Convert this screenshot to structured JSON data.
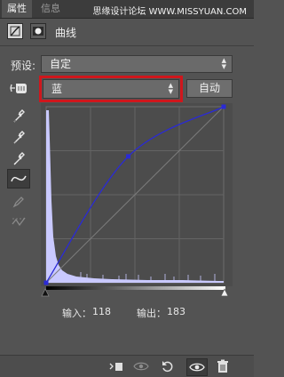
{
  "tabs": [
    {
      "label": "属性",
      "active": true
    },
    {
      "label": "信息",
      "active": false
    }
  ],
  "watermark": "思缘设计论坛 WWW.MISSYUAN.COM",
  "header": {
    "title": "曲线",
    "icons": [
      "curves-adjustment-icon",
      "mask-icon"
    ]
  },
  "preset": {
    "label": "预设:",
    "value": "自定"
  },
  "channel": {
    "value": "蓝",
    "highlight_color": "#d0161c"
  },
  "auto_button": {
    "label": "自动"
  },
  "tools": [
    "target-adjust-hand-icon",
    "eyedropper-black-icon",
    "eyedropper-gray-icon",
    "eyedropper-white-icon",
    "curve-edit-icon",
    "pencil-icon",
    "smooth-icon"
  ],
  "curve": {
    "color": "#2a2ad6",
    "points": [
      [
        0,
        0
      ],
      [
        118,
        183
      ],
      [
        255,
        255
      ]
    ],
    "histogram_color": "#c9c9ff"
  },
  "io": {
    "input_label": "输入：",
    "input_value": "118",
    "output_label": "输出：",
    "output_value": "183"
  },
  "bottom_icons": [
    "clip-to-layer-icon",
    "view-previous-state-icon",
    "reset-icon",
    "visibility-eye-icon",
    "trash-icon"
  ]
}
